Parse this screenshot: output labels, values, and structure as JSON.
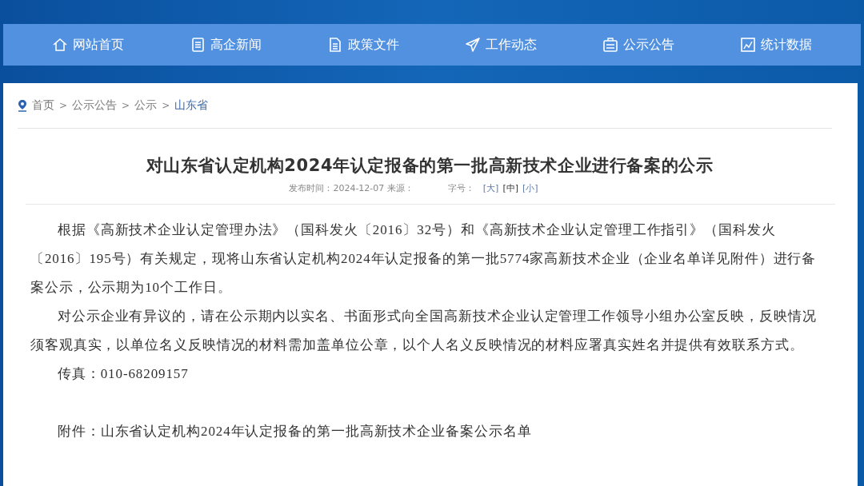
{
  "nav": [
    {
      "label": "网站首页"
    },
    {
      "label": "高企新闻"
    },
    {
      "label": "政策文件"
    },
    {
      "label": "工作动态"
    },
    {
      "label": "公示公告"
    },
    {
      "label": "统计数据"
    }
  ],
  "breadcrumb": [
    "首页",
    "公示公告",
    "公示",
    "山东省"
  ],
  "breadcrumb_separator": ">",
  "title": "对山东省认定机构2024年认定报备的第一批高新技术企业进行备案的公示",
  "meta": {
    "published": "发布时间：2024-12-07 来源：",
    "font_size_label": "字号：",
    "font_sizes": [
      {
        "label": "[大]",
        "selected": false
      },
      {
        "label": "[中]",
        "selected": true
      },
      {
        "label": "[小]",
        "selected": false
      }
    ]
  },
  "paragraphs": [
    {
      "text": "根据《高新技术企业认定管理办法》（国科发火〔2016〕32号）和《高新技术企业认定管理工作指引》（国科发火〔2016〕195号）有关规定，现将山东省认定机构2024年认定报备的第一批5774家高新技术企业（企业名单详见附件）进行备案公示，公示期为10个工作日。"
    },
    {
      "text": "对公示企业有异议的，请在公示期内以实名、书面形式向全国高新技术企业认定管理工作领导小组办公室反映，反映情况须客观真实，以单位名义反映情况的材料需加盖单位公章，以个人名义反映情况的材料应署真实姓名并提供有效联系方式。"
    },
    {
      "text": "传真：010-68209157"
    }
  ],
  "attachment": "附件：山东省认定机构2024年认定报备的第一批高新技术企业备案公示名单"
}
